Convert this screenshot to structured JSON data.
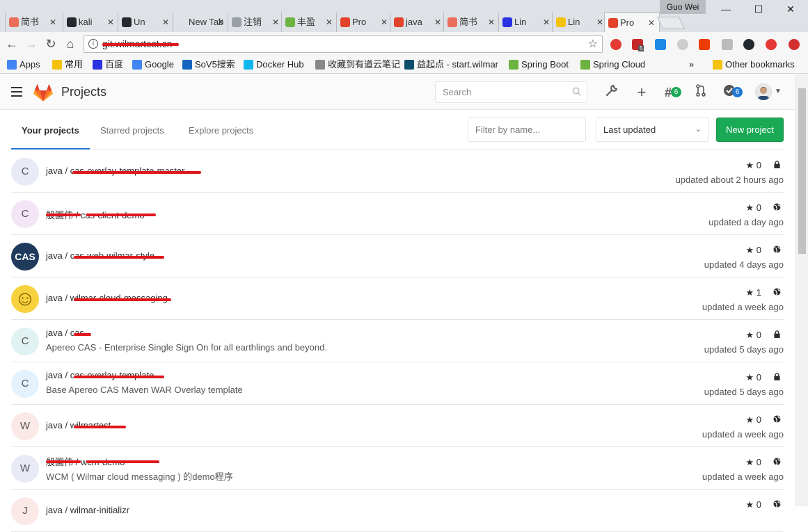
{
  "browser": {
    "user": "Guo Wei",
    "tabs": [
      {
        "title": "简书",
        "color": "#ea6f5a"
      },
      {
        "title": "kali",
        "color": "#24292e"
      },
      {
        "title": "Un",
        "color": "#24292e"
      },
      {
        "title": "New Tab",
        "color": "#dee1e6"
      },
      {
        "title": "注销",
        "color": "#9aa0a6"
      },
      {
        "title": "丰盈",
        "color": "#6db33f"
      },
      {
        "title": "Pro",
        "color": "#e24329"
      },
      {
        "title": "java",
        "color": "#e24329"
      },
      {
        "title": "简书",
        "color": "#ea6f5a"
      },
      {
        "title": "Lin",
        "color": "#2932e1"
      },
      {
        "title": "Lin",
        "color": "#f4c20d"
      },
      {
        "title": "Pro",
        "color": "#e24329"
      }
    ],
    "url": "git.wilmartest.cn",
    "bookmarks": [
      {
        "label": "Apps",
        "color": "#4285f4"
      },
      {
        "label": "常用",
        "color": "#f4c20d"
      },
      {
        "label": "百度",
        "color": "#2932e1"
      },
      {
        "label": "Google",
        "color": "#4285f4"
      },
      {
        "label": "SoV5搜索",
        "color": "#1565c0"
      },
      {
        "label": "Docker Hub",
        "color": "#0db7ed"
      },
      {
        "label": "收藏到有道云笔记",
        "color": "#888888"
      },
      {
        "label": "益起点 - start.wilmar",
        "color": "#0b4f6c"
      },
      {
        "label": "Spring Boot",
        "color": "#6db33f"
      },
      {
        "label": "Spring Cloud",
        "color": "#6db33f"
      }
    ],
    "other_bookmarks": "Other bookmarks",
    "overflow": "»",
    "extension_badge": "5"
  },
  "header": {
    "title": "Projects",
    "search_placeholder": "Search",
    "issues_count": "6",
    "todos_count": "6"
  },
  "tabs": [
    "Your projects",
    "Starred projects",
    "Explore projects"
  ],
  "filter_placeholder": "Filter by name...",
  "sort_label": "Last updated",
  "new_project_label": "New project",
  "projects": [
    {
      "avatar": "C",
      "avatar_bg": "#e8eaf6",
      "namespace": "java / ",
      "name": "cas-overlay-template-master",
      "description": "",
      "stars": "0",
      "visibility": "private",
      "updated": "updated about 2 hours ago"
    },
    {
      "avatar": "C",
      "avatar_bg": "#f3e5f5",
      "namespace": "殷国伟 / ",
      "name": "cas-client-demo",
      "description": "",
      "stars": "0",
      "visibility": "public",
      "updated": "updated a day ago"
    },
    {
      "avatar": "CAS",
      "avatar_bg": "#1f3a5a",
      "namespace": "java / ",
      "name": "cas-web-wilmar-style",
      "description": "",
      "stars": "0",
      "visibility": "public",
      "updated": "updated 4 days ago"
    },
    {
      "avatar": "☺",
      "avatar_bg": "#f7d23e",
      "namespace": "java / ",
      "name": "wilmar-cloud-messaging",
      "description": "",
      "stars": "1",
      "visibility": "public",
      "updated": "updated a week ago"
    },
    {
      "avatar": "C",
      "avatar_bg": "#e0f2f1",
      "namespace": "java / ",
      "name": "cas",
      "description": "Apereo CAS - Enterprise Single Sign On for all earthlings and beyond.",
      "stars": "0",
      "visibility": "private",
      "updated": "updated 5 days ago"
    },
    {
      "avatar": "C",
      "avatar_bg": "#e3f2fd",
      "namespace": "java / ",
      "name": "cas-overlay-template",
      "description": "Base Apereo CAS Maven WAR Overlay template",
      "stars": "0",
      "visibility": "private",
      "updated": "updated 5 days ago"
    },
    {
      "avatar": "W",
      "avatar_bg": "#fbe9e7",
      "namespace": "java / ",
      "name": "wilmartest",
      "description": "",
      "stars": "0",
      "visibility": "public",
      "updated": "updated a week ago"
    },
    {
      "avatar": "W",
      "avatar_bg": "#e8eaf6",
      "namespace": "殷国伟 / ",
      "name": "wcm-demo",
      "description": "WCM ( Wilmar cloud messaging ) 的demo程序",
      "stars": "0",
      "visibility": "public",
      "updated": "updated a week ago"
    },
    {
      "avatar": "J",
      "avatar_bg": "#fbe9e7",
      "namespace": "java / ",
      "name": "wilmar-initializr",
      "description": "",
      "stars": "0",
      "visibility": "public",
      "updated": ""
    }
  ]
}
